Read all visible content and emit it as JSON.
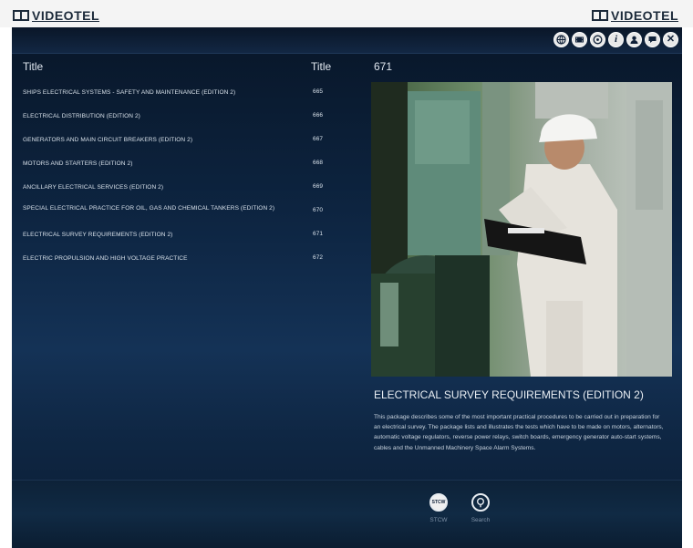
{
  "brand": {
    "left_logo": "VIDEOTEL",
    "right_logo": "VIDEOTEL"
  },
  "toolbar": {
    "buttons": [
      {
        "icon": "globe-icon"
      },
      {
        "icon": "film-icon"
      },
      {
        "icon": "disc-icon"
      },
      {
        "icon": "info-icon",
        "glyph": "i"
      },
      {
        "icon": "user-icon"
      },
      {
        "icon": "chat-icon"
      },
      {
        "icon": "close-icon",
        "glyph": "✕"
      }
    ]
  },
  "list": {
    "header_title": "Title",
    "header_number": "Title",
    "items": [
      {
        "title": "SHIPS ELECTRICAL SYSTEMS - SAFETY AND MAINTENANCE (EDITION 2)",
        "number": "665"
      },
      {
        "title": "ELECTRICAL DISTRIBUTION (EDITION 2)",
        "number": "666"
      },
      {
        "title": "GENERATORS AND MAIN CIRCUIT BREAKERS (EDITION 2)",
        "number": "667"
      },
      {
        "title": "MOTORS AND STARTERS (EDITION 2)",
        "number": "668"
      },
      {
        "title": "ANCILLARY ELECTRICAL SERVICES (EDITION 2)",
        "number": "669"
      },
      {
        "title": "SPECIAL ELECTRICAL PRACTICE FOR OIL, GAS AND CHEMICAL TANKERS (EDITION 2)",
        "number": "670"
      },
      {
        "title": "ELECTRICAL SURVEY REQUIREMENTS (EDITION 2)",
        "number": "671"
      },
      {
        "title": "ELECTRIC PROPULSION AND HIGH VOLTAGE PRACTICE",
        "number": "672"
      }
    ]
  },
  "detail": {
    "number": "671",
    "title": "ELECTRICAL SURVEY REQUIREMENTS (EDITION 2)",
    "description": "This package describes some of the most important practical procedures to be carried out in preparation for an electrical survey. The package lists and illustrates the tests which have to be made on motors, alternators, automatic voltage regulators, reverse power relays, switch boards, emergency generator auto-start systems, cables and the Unmanned Machinery Space Alarm Systems."
  },
  "footer": {
    "stcw_label": "STCW",
    "stcw_badge": "STCW",
    "search_label": "Search"
  },
  "colors": {
    "accent": "#143256",
    "text": "#d8e1ea",
    "header_bg": "#f4f4f4"
  }
}
